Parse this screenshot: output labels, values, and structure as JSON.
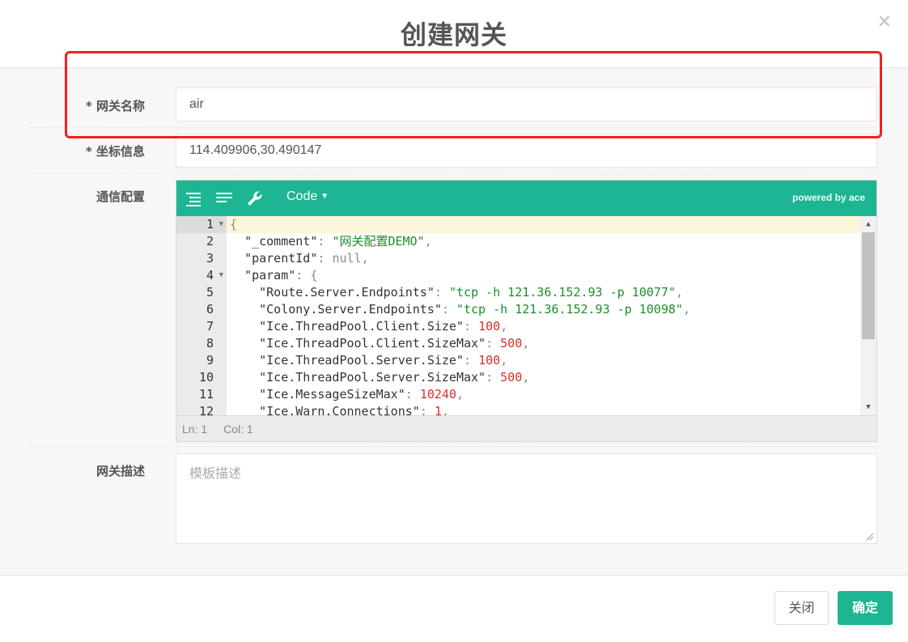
{
  "modal": {
    "title": "创建网关",
    "close_glyph": "×"
  },
  "form": {
    "name_label": "* 网关名称",
    "name_value": "air",
    "coords_label": "* 坐标信息",
    "coords_value": "114.409906,30.490147",
    "comm_label": "通信配置",
    "desc_label": "网关描述",
    "desc_placeholder": "模板描述"
  },
  "editor": {
    "toolbar": {
      "mode_label": "Code",
      "mode_caret": "▼",
      "powered": "powered by ace",
      "icons": [
        "format-icon",
        "compact-icon",
        "wrench-icon"
      ]
    },
    "line_numbers": [
      "1",
      "2",
      "3",
      "4",
      "5",
      "6",
      "7",
      "8",
      "9",
      "10",
      "11",
      "12"
    ],
    "lines": [
      [
        {
          "t": "{",
          "c": "punc"
        }
      ],
      [
        {
          "t": "  ",
          "c": "key"
        },
        {
          "t": "\"_comment\"",
          "c": "key"
        },
        {
          "t": ": ",
          "c": "punc"
        },
        {
          "t": "\"网关配置DEMO\"",
          "c": "str"
        },
        {
          "t": ",",
          "c": "punc"
        }
      ],
      [
        {
          "t": "  ",
          "c": "key"
        },
        {
          "t": "\"parentId\"",
          "c": "key"
        },
        {
          "t": ": ",
          "c": "punc"
        },
        {
          "t": "null",
          "c": "null"
        },
        {
          "t": ",",
          "c": "punc"
        }
      ],
      [
        {
          "t": "  ",
          "c": "key"
        },
        {
          "t": "\"param\"",
          "c": "key"
        },
        {
          "t": ": {",
          "c": "punc"
        }
      ],
      [
        {
          "t": "    ",
          "c": "key"
        },
        {
          "t": "\"Route.Server.Endpoints\"",
          "c": "key"
        },
        {
          "t": ": ",
          "c": "punc"
        },
        {
          "t": "\"tcp -h 121.36.152.93 -p 10077\"",
          "c": "str"
        },
        {
          "t": ",",
          "c": "punc"
        }
      ],
      [
        {
          "t": "    ",
          "c": "key"
        },
        {
          "t": "\"Colony.Server.Endpoints\"",
          "c": "key"
        },
        {
          "t": ": ",
          "c": "punc"
        },
        {
          "t": "\"tcp -h 121.36.152.93 -p 10098\"",
          "c": "str"
        },
        {
          "t": ",",
          "c": "punc"
        }
      ],
      [
        {
          "t": "    ",
          "c": "key"
        },
        {
          "t": "\"Ice.ThreadPool.Client.Size\"",
          "c": "key"
        },
        {
          "t": ": ",
          "c": "punc"
        },
        {
          "t": "100",
          "c": "num"
        },
        {
          "t": ",",
          "c": "punc"
        }
      ],
      [
        {
          "t": "    ",
          "c": "key"
        },
        {
          "t": "\"Ice.ThreadPool.Client.SizeMax\"",
          "c": "key"
        },
        {
          "t": ": ",
          "c": "punc"
        },
        {
          "t": "500",
          "c": "num"
        },
        {
          "t": ",",
          "c": "punc"
        }
      ],
      [
        {
          "t": "    ",
          "c": "key"
        },
        {
          "t": "\"Ice.ThreadPool.Server.Size\"",
          "c": "key"
        },
        {
          "t": ": ",
          "c": "punc"
        },
        {
          "t": "100",
          "c": "num"
        },
        {
          "t": ",",
          "c": "punc"
        }
      ],
      [
        {
          "t": "    ",
          "c": "key"
        },
        {
          "t": "\"Ice.ThreadPool.Server.SizeMax\"",
          "c": "key"
        },
        {
          "t": ": ",
          "c": "punc"
        },
        {
          "t": "500",
          "c": "num"
        },
        {
          "t": ",",
          "c": "punc"
        }
      ],
      [
        {
          "t": "    ",
          "c": "key"
        },
        {
          "t": "\"Ice.MessageSizeMax\"",
          "c": "key"
        },
        {
          "t": ": ",
          "c": "punc"
        },
        {
          "t": "10240",
          "c": "num"
        },
        {
          "t": ",",
          "c": "punc"
        }
      ],
      [
        {
          "t": "    ",
          "c": "key"
        },
        {
          "t": "\"Ice.Warn.Connections\"",
          "c": "key"
        },
        {
          "t": ": ",
          "c": "punc"
        },
        {
          "t": "1",
          "c": "num"
        },
        {
          "t": ",",
          "c": "punc"
        }
      ]
    ],
    "fold_lines": [
      1,
      4
    ],
    "active_line": 1,
    "status": {
      "ln": "Ln: 1",
      "col": "Col: 1"
    }
  },
  "footer": {
    "close_label": "关闭",
    "ok_label": "确定"
  },
  "colors": {
    "accent": "#1eb594",
    "highlight": "#ee2222",
    "string": "#1d8f2a",
    "number": "#e02a2a"
  }
}
